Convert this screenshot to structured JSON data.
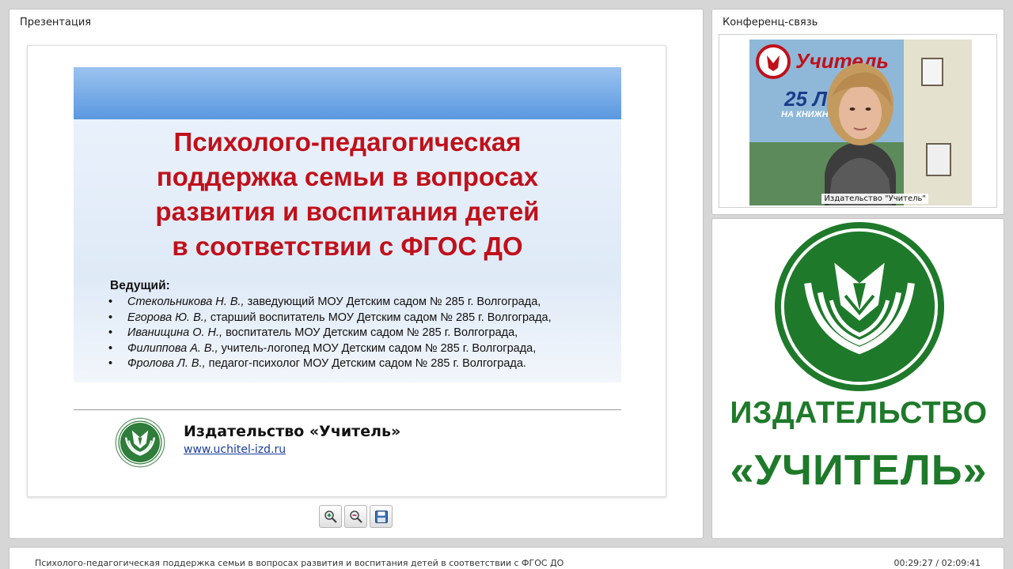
{
  "presentation_panel": {
    "title": "Презентация"
  },
  "slide": {
    "title_lines": [
      "Психолого-педагогическая",
      "поддержка семьи в вопросах",
      "развития и воспитания детей",
      "в соответствии с ФГОС ДО"
    ],
    "presenter_label": "Ведущий:",
    "presenters": [
      {
        "bullet": "•",
        "name": "Стекольникова Н. В.,",
        "role": " заведующий МОУ Детским садом № 285 г. Волгограда,"
      },
      {
        "bullet": "•",
        "name": "Егорова Ю. В.,",
        "role": " старший воспитатель МОУ Детским садом № 285 г. Волгограда,"
      },
      {
        "bullet": "•",
        "name": "Иванищина О. Н.,",
        "role": " воспитатель МОУ Детским садом № 285 г. Волгограда,"
      },
      {
        "bullet": "•",
        "name": "Филиппова А. В.,",
        "role": " учитель-логопед МОУ Детским садом № 285 г. Волгограда,"
      },
      {
        "bullet": "•",
        "name": "Фролова Л. В.,",
        "role": " педагог-психолог МОУ Детским садом № 285 г. Волгограда."
      }
    ],
    "publisher_name": "Издательство «Учитель»",
    "publisher_url": "www.uchitel-izd.ru"
  },
  "toolbar": {
    "zoom_in_icon": "zoom-in-icon",
    "zoom_out_icon": "zoom-out-icon",
    "save_icon": "floppy-disk-icon"
  },
  "conference_panel": {
    "title": "Конференц-связь",
    "camera_label": "Издательство \"Учитель\"",
    "backdrop_text_1": "Учитель",
    "backdrop_text_2": "25 ЛЕТ",
    "backdrop_text_3": "НА КНИЖНОМ"
  },
  "logo_panel": {
    "line1": "ИЗДАТЕЛЬСТВО",
    "line2": "«УЧИТЕЛЬ»"
  },
  "bottom_bar": {
    "title": "Психолого-педагогическая поддержка семьи в вопросах развития и воспитания детей в соответствии с ФГОС ДО",
    "time": "00:29:27 / 02:09:41"
  },
  "colors": {
    "title_red": "#c0101a",
    "brand_green": "#1e7a2a",
    "header_blue": "#5a98e0"
  }
}
